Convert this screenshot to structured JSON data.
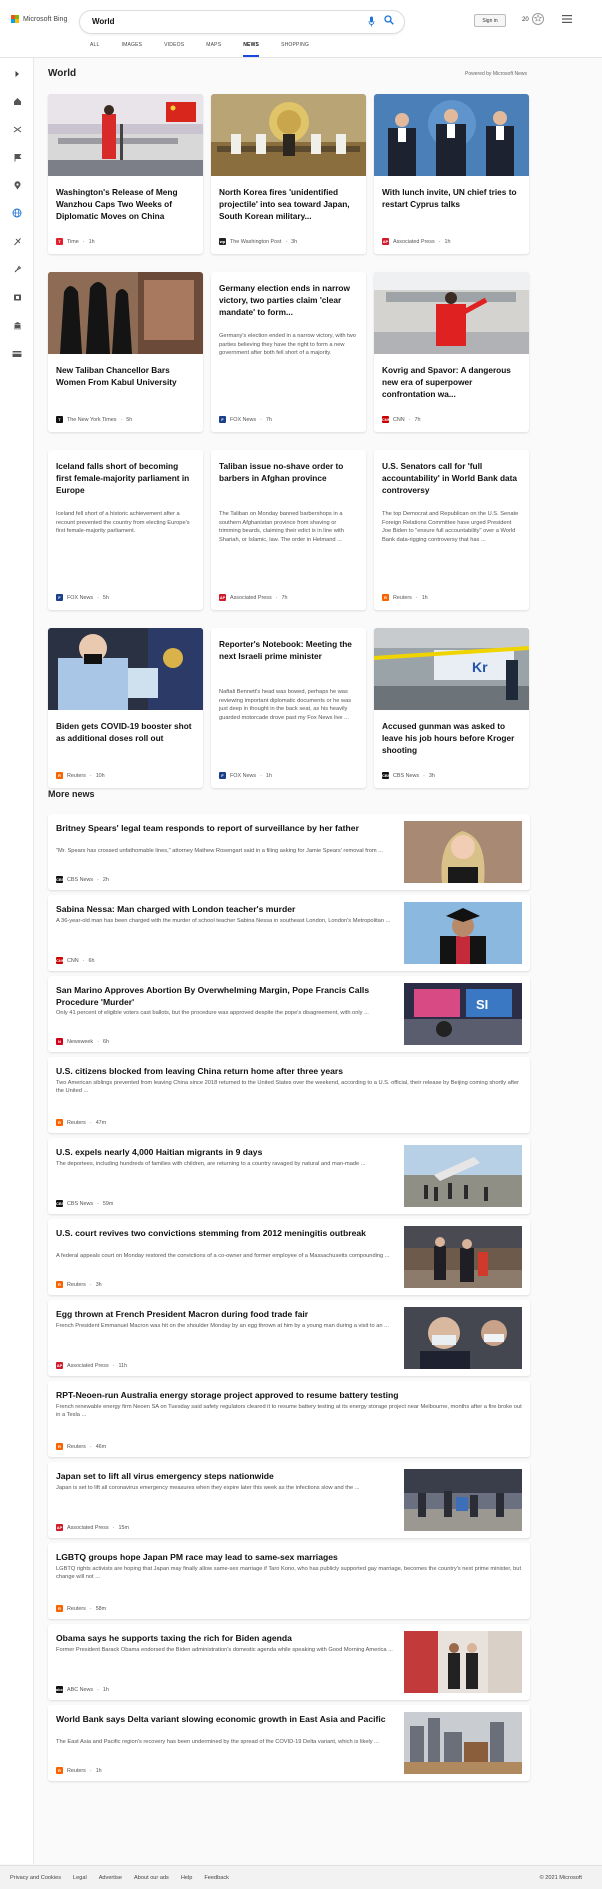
{
  "header": {
    "logo_text": "Microsoft Bing",
    "query": "World",
    "signin": "Sign in",
    "rewards_count": "20"
  },
  "tabs": [
    "ALL",
    "IMAGES",
    "VIDEOS",
    "MAPS",
    "NEWS",
    "SHOPPING"
  ],
  "active_tab": "NEWS",
  "rail_icons": [
    "chevron-right-icon",
    "home-icon",
    "shuffle-icon",
    "flag-icon",
    "location-pin-icon",
    "globe-icon",
    "briefcase-icon",
    "rocket-icon",
    "film-icon",
    "bank-icon",
    "card-icon"
  ],
  "section": {
    "title": "World",
    "powered": "Powered by Microsoft News"
  },
  "cards": [
    {
      "title": "Washington's Release of Meng Wanzhou Caps Two Weeks of Diplomatic Moves on China",
      "source": "Time",
      "age": "1h",
      "logo": "T",
      "logo_color": "#e4202e",
      "img": "meng"
    },
    {
      "title": "North Korea fires 'unidentified projectile' into sea toward Japan, South Korean military...",
      "source": "The Washington Post",
      "age": "3h",
      "logo": "wp",
      "logo_color": "#222222",
      "img": "nk"
    },
    {
      "title": "With lunch invite, UN chief tries to restart Cyprus talks",
      "source": "Associated Press",
      "age": "1h",
      "logo": "AP",
      "logo_color": "#d11a2a",
      "img": "un"
    },
    {
      "title": "New Taliban Chancellor Bars Women From Kabul University",
      "source": "The New York Times",
      "age": "5h",
      "logo": "T",
      "logo_color": "#111111",
      "img": "taliban"
    },
    {
      "title": "Germany election ends in narrow victory, two parties claim 'clear mandate' to form...",
      "snippet": "Germany's election ended in a narrow victory, with two parties believing they have the right to form a new government after both fell short of a majority.",
      "source": "FOX News",
      "age": "7h",
      "logo": "F",
      "logo_color": "#1a3f8b"
    },
    {
      "title": "Kovrig and Spavor: A dangerous new era of superpower confrontation wa...",
      "source": "CNN",
      "age": "7h",
      "logo": "CNN",
      "logo_color": "#cc0000",
      "img": "kovrig"
    },
    {
      "title": "Iceland falls short of becoming first female-majority parliament in Europe",
      "snippet": "Iceland fell short of a historic achievement after a recount prevented the country from electing Europe's first female-majority parliament.",
      "source": "FOX News",
      "age": "5h",
      "logo": "F",
      "logo_color": "#1a3f8b"
    },
    {
      "title": "Taliban issue no-shave order to barbers in Afghan province",
      "snippet": "The Taliban on Monday banned barbershops in a southern Afghanistan province from shaving or trimming beards, claiming their edict is in line with Shariah, or Islamic, law. The order in Helmand ...",
      "source": "Associated Press",
      "age": "7h",
      "logo": "AP",
      "logo_color": "#d11a2a"
    },
    {
      "title": "U.S. Senators call for 'full accountability' in World Bank data controversy",
      "snippet": "The top Democrat and Republican on the U.S. Senate Foreign Relations Committee have urged President Joe Biden to \"ensure full accountability\" over a World Bank data-rigging controversy that has ...",
      "source": "Reuters",
      "age": "1h",
      "logo": "R",
      "logo_color": "#fa6400"
    },
    {
      "title": "Biden gets COVID-19 booster shot as additional doses roll out",
      "source": "Reuters",
      "age": "10h",
      "logo": "R",
      "logo_color": "#fa6400",
      "img": "biden"
    },
    {
      "title": "Reporter's Notebook: Meeting the next Israeli prime minister",
      "snippet": "Naftali Bennett's head was bowed, perhaps he was reviewing important diplomatic documents or he was just deep in thought in the back seat, as his heavily guarded motorcade drove past my Fox News live ...",
      "source": "FOX News",
      "age": "1h",
      "logo": "F",
      "logo_color": "#1a3f8b"
    },
    {
      "title": "Accused gunman was asked to leave his job hours before Kroger shooting",
      "source": "CBS News",
      "age": "3h",
      "logo": "CBS",
      "logo_color": "#111111",
      "img": "kroger"
    }
  ],
  "more_news_title": "More news",
  "more_news": [
    {
      "title": "Britney Spears' legal team responds to report of surveillance by her father",
      "snippet": "\"Mr. Spears has crossed unfathomable lines,\" attorney Mathew Rosengart said in a filing asking for Jamie Spears' removal from ...",
      "source": "CBS News",
      "age": "2h",
      "logo": "CBS",
      "logo_color": "#111111",
      "img": "britney"
    },
    {
      "title": "Sabina Nessa: Man charged with London teacher's murder",
      "snippet": "A 36-year-old man has been charged with the murder of school teacher Sabina Nessa in southeast London, London's Metropolitan ...",
      "source": "CNN",
      "age": "6h",
      "logo": "CNN",
      "logo_color": "#cc0000",
      "img": "sabina"
    },
    {
      "title": "San Marino Approves Abortion By Overwhelming Margin, Pope Francis Calls Procedure 'Murder'",
      "snippet": "Only 41 percent of eligible voters cast ballots, but the procedure was approved despite the pope's disagreement, with only ...",
      "source": "Newsweek",
      "age": "6h",
      "logo": "N",
      "logo_color": "#d0021b",
      "img": "sanmarino"
    },
    {
      "title": "U.S. citizens blocked from leaving China return home after three years",
      "snippet": "Two American siblings prevented from leaving China since 2018 returned to the United States over the weekend, according to a U.S. official, their release by Beijing coming shortly after the United ...",
      "source": "Reuters",
      "age": "47m",
      "logo": "R",
      "logo_color": "#fa6400"
    },
    {
      "title": "U.S. expels nearly 4,000 Haitian migrants in 9 days",
      "snippet": "The deportees, including hundreds of families with children, are returning to a country ravaged by natural and man-made ...",
      "source": "CBS News",
      "age": "59m",
      "logo": "CBS",
      "logo_color": "#111111",
      "img": "haiti"
    },
    {
      "title": "U.S. court revives two convictions stemming from 2012 meningitis outbreak",
      "snippet": "A federal appeals court on Monday restored the convictions of a co-owner and former employee of a Massachusetts compounding ...",
      "source": "Reuters",
      "age": "3h",
      "logo": "R",
      "logo_color": "#fa6400",
      "img": "court"
    },
    {
      "title": "Egg thrown at French President Macron during food trade fair",
      "snippet": "French President Emmanuel Macron was hit on the shoulder Monday by an egg thrown at him by a young man during a visit to an ...",
      "source": "Associated Press",
      "age": "11h",
      "logo": "AP",
      "logo_color": "#d11a2a",
      "img": "macron"
    },
    {
      "title": "RPT-Neoen-run Australia energy storage project approved to resume battery testing",
      "snippet": "French renewable energy firm Neoen SA on Tuesday said safety regulators cleared it to resume battery testing at its energy storage project near Melbourne, months after a fire broke out in a Tesla ...",
      "source": "Reuters",
      "age": "46m",
      "logo": "R",
      "logo_color": "#fa6400"
    },
    {
      "title": "Japan set to lift all virus emergency steps nationwide",
      "snippet": "Japan is set to lift all coronavirus emergency measures when they expire later this week as the infections slow and the ...",
      "source": "Associated Press",
      "age": "15m",
      "logo": "AP",
      "logo_color": "#d11a2a",
      "img": "japan"
    },
    {
      "title": "LGBTQ groups hope Japan PM race may lead to same-sex marriages",
      "snippet": "LGBTQ rights activists are hoping that Japan may finally allow same-sex marriage if Taro Kono, who has publicly supported gay marriage, becomes the country's next prime minister, but change will not ...",
      "source": "Reuters",
      "age": "58m",
      "logo": "R",
      "logo_color": "#fa6400"
    },
    {
      "title": "Obama says he supports taxing the rich for Biden agenda",
      "snippet": "Former President Barack Obama endorsed the Biden administration's domestic agenda while speaking with Good Morning America ...",
      "source": "ABC News",
      "age": "1h",
      "logo": "abc",
      "logo_color": "#111111",
      "img": "obama"
    },
    {
      "title": "World Bank says Delta variant slowing economic growth in East Asia and Pacific",
      "snippet": "The East Asia and Pacific region's recovery has been undermined by the spread of the COVID-19 Delta variant, which is likely ...",
      "source": "Reuters",
      "age": "1h",
      "logo": "R",
      "logo_color": "#fa6400",
      "img": "worldbank"
    }
  ],
  "footer": {
    "links": [
      "Privacy and Cookies",
      "Legal",
      "Advertise",
      "About our ads",
      "Help",
      "Feedback"
    ],
    "copyright": "© 2021 Microsoft"
  }
}
